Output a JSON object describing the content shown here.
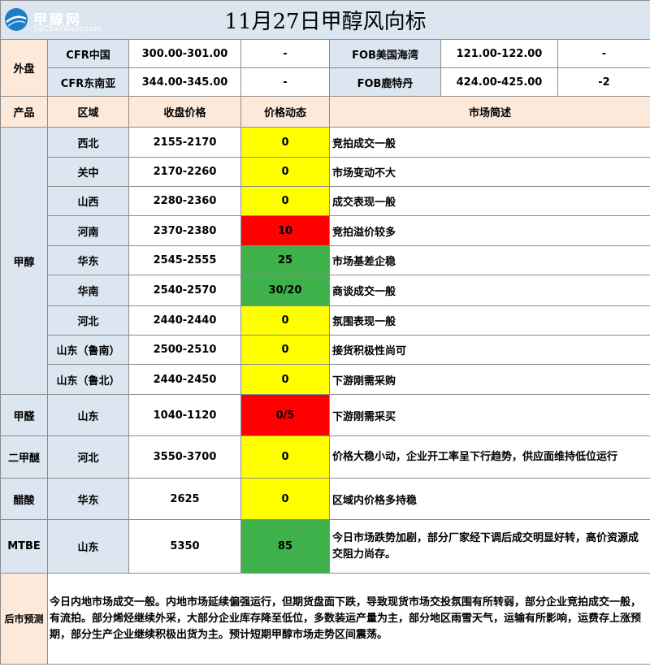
{
  "header": {
    "title": "11月27日甲醇风向标",
    "logo_name": "甲醇网",
    "logo_url": "JiaChunWang.com"
  },
  "outer": {
    "label": "外盘",
    "rows": [
      {
        "left_name": "CFR中国",
        "left_price": "300.00-301.00",
        "left_change": "-",
        "right_name": "FOB美国海湾",
        "right_price": "121.00-122.00",
        "right_change": "-"
      },
      {
        "left_name": "CFR东南亚",
        "left_price": "344.00-345.00",
        "left_change": "-",
        "right_name": "FOB鹿特丹",
        "right_price": "424.00-425.00",
        "right_change": "-2"
      }
    ]
  },
  "columns": {
    "product": "产品",
    "region": "区域",
    "price": "收盘价格",
    "change": "价格动态",
    "summary": "市场简述"
  },
  "groups": [
    {
      "product": "甲醇",
      "rows": [
        {
          "region": "西北",
          "price": "2155-2170",
          "change": "0",
          "status": "yellow",
          "summary": "竞拍成交一般"
        },
        {
          "region": "关中",
          "price": "2170-2260",
          "change": "0",
          "status": "yellow",
          "summary": "市场变动不大"
        },
        {
          "region": "山西",
          "price": "2280-2360",
          "change": "0",
          "status": "yellow",
          "summary": "成交表现一般"
        },
        {
          "region": "河南",
          "price": "2370-2380",
          "change": "10",
          "status": "red",
          "summary": "竞拍溢价较多"
        },
        {
          "region": "华东",
          "price": "2545-2555",
          "change": "25",
          "status": "green",
          "summary": "市场基差企稳"
        },
        {
          "region": "华南",
          "price": "2540-2570",
          "change": "30/20",
          "status": "green",
          "summary": "商谈成交一般"
        },
        {
          "region": "河北",
          "price": "2440-2440",
          "change": "0",
          "status": "yellow",
          "summary": "氛围表现一般"
        },
        {
          "region": "山东（鲁南）",
          "price": "2500-2510",
          "change": "0",
          "status": "yellow",
          "summary": "接货积极性尚可"
        },
        {
          "region": "山东（鲁北）",
          "price": "2440-2450",
          "change": "0",
          "status": "yellow",
          "summary": "下游刚需采购"
        }
      ]
    },
    {
      "product": "甲醛",
      "rows": [
        {
          "region": "山东",
          "price": "1040-1120",
          "change": "0/5",
          "status": "red",
          "summary": "下游刚需采买"
        }
      ]
    },
    {
      "product": "二甲醚",
      "rows": [
        {
          "region": "河北",
          "price": "3550-3700",
          "change": "0",
          "status": "yellow",
          "summary": "价格大稳小动，企业开工率呈下行趋势，供应面维持低位运行"
        }
      ]
    },
    {
      "product": "醋酸",
      "rows": [
        {
          "region": "华东",
          "price": "2625",
          "change": "0",
          "status": "yellow",
          "summary": "区域内价格多持稳"
        }
      ]
    },
    {
      "product": "MTBE",
      "rows": [
        {
          "region": "山东",
          "price": "5350",
          "change": "85",
          "status": "green",
          "summary": "今日市场跌势加剧，部分厂家经下调后成交明显好转，高价资源成交阻力尚存。"
        }
      ]
    }
  ],
  "forecast": {
    "label": "后市预测",
    "text": "今日内地市场成交一般。内地市场延续偏强运行，但期货盘面下跌，导致现货市场交投氛围有所转弱，部分企业竞拍成交一般，有流拍。部分烯烃继续外采，大部分企业库存降至低位，多数装运产量为主，部分地区雨雪天气，运输有所影响，运费存上涨预期，部分生产企业继续积极出货为主。预计短期甲醇市场走势区间震荡。"
  },
  "colors": {
    "header_bg": "#dce6f1",
    "label_bg": "#fde9d9",
    "up": "#ff0000",
    "flat": "#ffff00",
    "strong_up": "#3eb14a"
  }
}
